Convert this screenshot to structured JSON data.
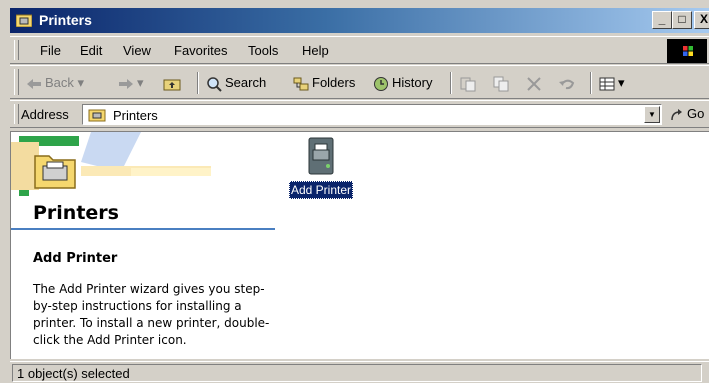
{
  "window": {
    "title": "Printers"
  },
  "controls": {
    "minimize": "_",
    "maximize": "□",
    "close": "X"
  },
  "menu": [
    {
      "label": "File"
    },
    {
      "label": "Edit"
    },
    {
      "label": "View"
    },
    {
      "label": "Favorites"
    },
    {
      "label": "Tools"
    },
    {
      "label": "Help"
    }
  ],
  "toolbar": {
    "back": "Back",
    "search": "Search",
    "folders": "Folders",
    "history": "History"
  },
  "address": {
    "label": "Address",
    "value": "Printers",
    "go": "Go"
  },
  "webview": {
    "heading": "Printers",
    "subheading": "Add Printer",
    "description": "The Add Printer wizard gives you step-by-step instructions for installing a printer. To install a new printer, double-click the Add Printer icon."
  },
  "items": [
    {
      "label": "Add Printer",
      "icon": "add-printer-icon",
      "selected": true
    }
  ],
  "status": {
    "text": "1 object(s) selected"
  },
  "colors": {
    "title_start": "#0a246a",
    "title_end": "#a6caf0",
    "face": "#d4d0c8",
    "selection": "#0a246a"
  }
}
